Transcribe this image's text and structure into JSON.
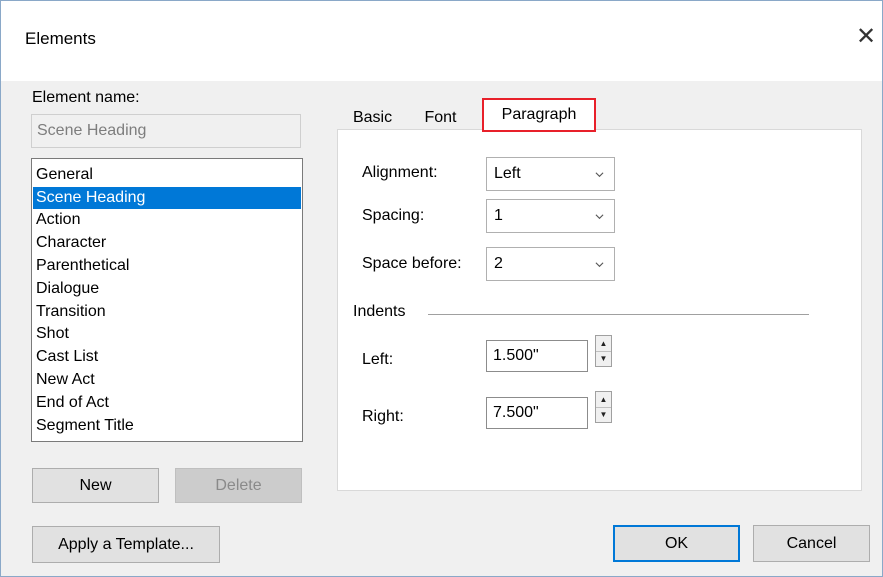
{
  "window": {
    "title": "Elements",
    "close_glyph": "✕"
  },
  "element_name": {
    "label": "Element name:",
    "value": "Scene Heading"
  },
  "elements_list": {
    "items": [
      "General",
      "Scene Heading",
      "Action",
      "Character",
      "Parenthetical",
      "Dialogue",
      "Transition",
      "Shot",
      "Cast List",
      "New Act",
      "End of Act",
      "Segment Title"
    ],
    "selected": "Scene Heading"
  },
  "buttons": {
    "new": "New",
    "delete": "Delete",
    "apply_template": "Apply a Template...",
    "ok": "OK",
    "cancel": "Cancel"
  },
  "tabs": {
    "basic": "Basic",
    "font": "Font",
    "paragraph": "Paragraph",
    "active": "Paragraph"
  },
  "paragraph": {
    "alignment": {
      "label": "Alignment:",
      "value": "Left"
    },
    "spacing": {
      "label": "Spacing:",
      "value": "1"
    },
    "space_before": {
      "label": "Space before:",
      "value": "2"
    },
    "indents": {
      "label": "Indents",
      "left": {
        "label": "Left:",
        "value": "1.500\""
      },
      "right": {
        "label": "Right:",
        "value": "7.500\""
      }
    }
  },
  "colors": {
    "selection": "#0078d7",
    "tab_highlight": "#e8202a",
    "dialog_bg": "#f0f0f0"
  },
  "icons": {
    "close": "close-icon",
    "dropdown": "chevron-down-icon",
    "spin_up": "spin-up-icon",
    "spin_down": "spin-down-icon"
  }
}
